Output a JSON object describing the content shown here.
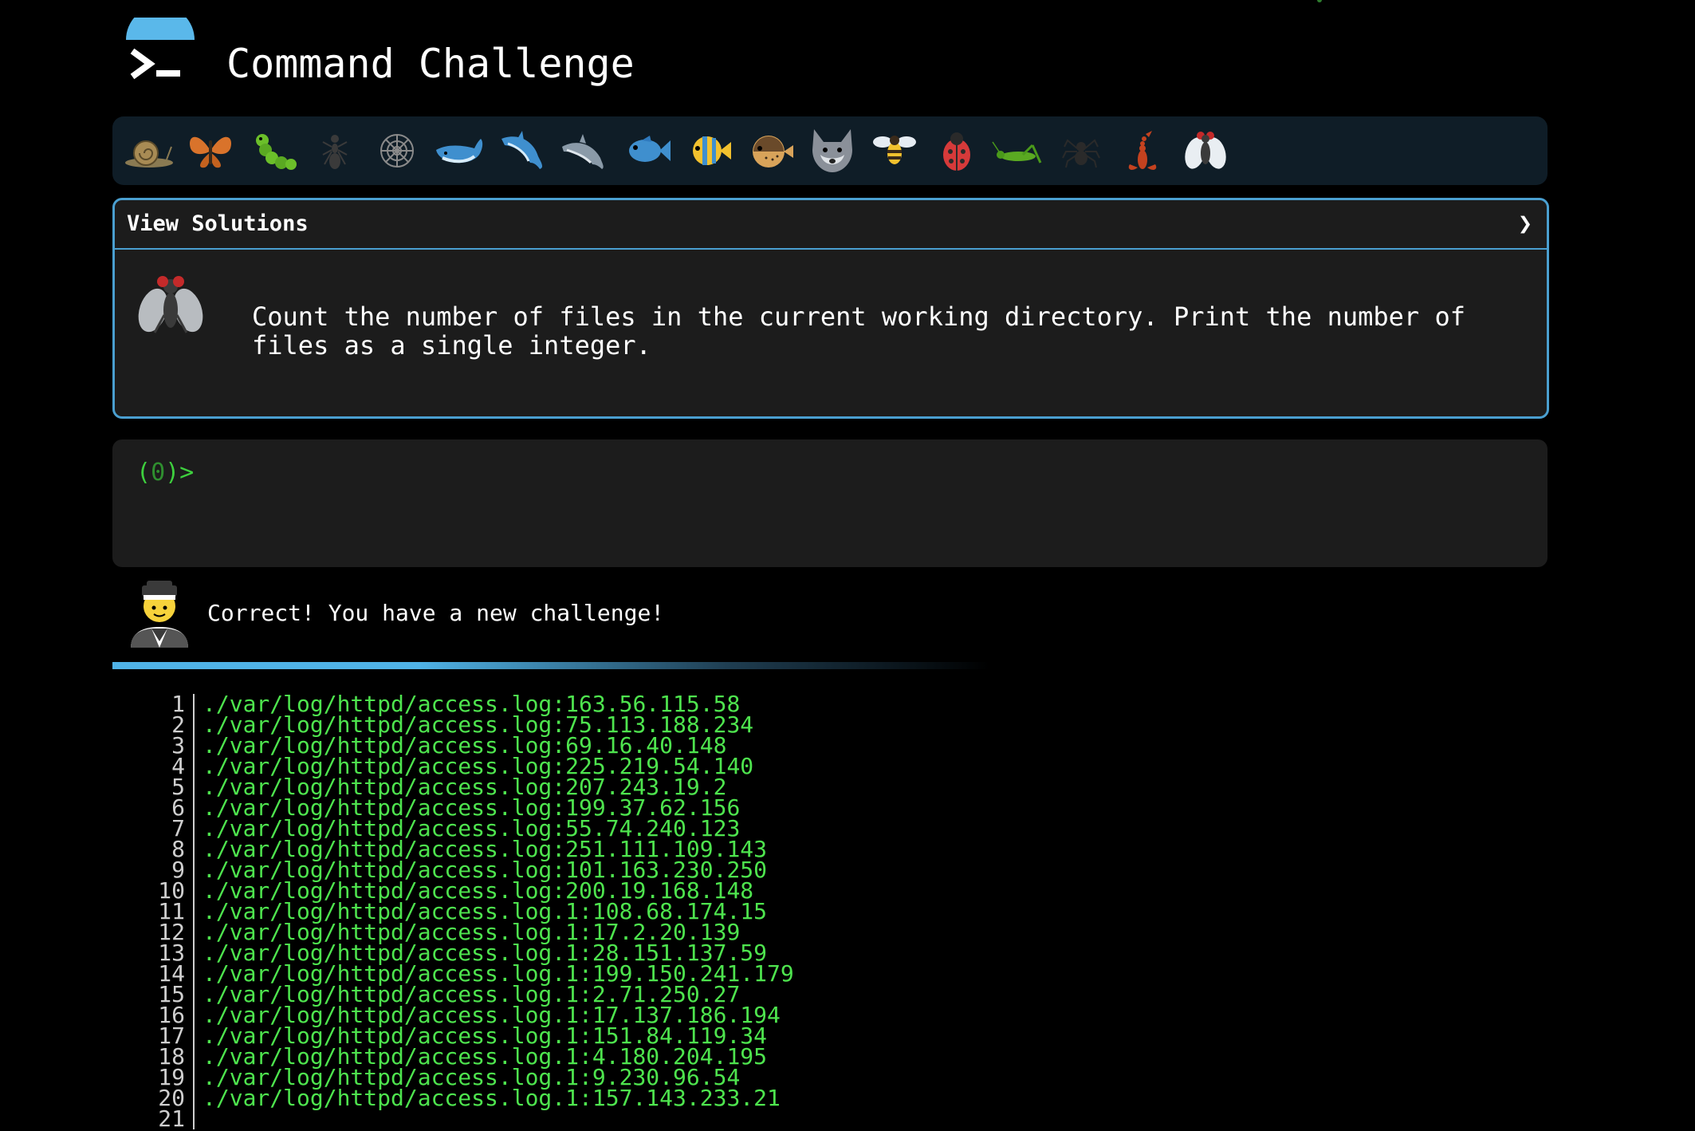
{
  "header": {
    "title": "Command Challenge",
    "logo_icon": "terminal-prompt-icon"
  },
  "challenge_icons": [
    "snail-icon",
    "butterfly-icon",
    "caterpillar-icon",
    "ant-icon",
    "spider-web-icon",
    "whale-icon",
    "dolphin-icon",
    "dolphin-icon",
    "fish-icon",
    "tropical-fish-icon",
    "blowfish-icon",
    "wolf-icon",
    "bee-icon",
    "ladybug-icon",
    "cricket-icon",
    "spider-icon",
    "scorpion-icon",
    "fly-icon"
  ],
  "solutions": {
    "label": "View Solutions",
    "chevron": "❯"
  },
  "challenge": {
    "icon": "fly-icon",
    "text": "Count the number of files in the current working directory. Print the number of files as a single integer."
  },
  "terminal": {
    "prompt_open": "(",
    "prompt_count": "0",
    "prompt_close": ")>",
    "input": ""
  },
  "status": {
    "avatar_icon": "student-avatar-icon",
    "message": "Correct! You have a new challenge!"
  },
  "output_lines": [
    {
      "num": "1",
      "text": "./var/log/httpd/access.log:163.56.115.58"
    },
    {
      "num": "2",
      "text": "./var/log/httpd/access.log:75.113.188.234"
    },
    {
      "num": "3",
      "text": "./var/log/httpd/access.log:69.16.40.148"
    },
    {
      "num": "4",
      "text": "./var/log/httpd/access.log:225.219.54.140"
    },
    {
      "num": "5",
      "text": "./var/log/httpd/access.log:207.243.19.2"
    },
    {
      "num": "6",
      "text": "./var/log/httpd/access.log:199.37.62.156"
    },
    {
      "num": "7",
      "text": "./var/log/httpd/access.log:55.74.240.123"
    },
    {
      "num": "8",
      "text": "./var/log/httpd/access.log:251.111.109.143"
    },
    {
      "num": "9",
      "text": "./var/log/httpd/access.log:101.163.230.250"
    },
    {
      "num": "10",
      "text": "./var/log/httpd/access.log:200.19.168.148"
    },
    {
      "num": "11",
      "text": "./var/log/httpd/access.log.1:108.68.174.15"
    },
    {
      "num": "12",
      "text": "./var/log/httpd/access.log.1:17.2.20.139"
    },
    {
      "num": "13",
      "text": "./var/log/httpd/access.log.1:28.151.137.59"
    },
    {
      "num": "14",
      "text": "./var/log/httpd/access.log.1:199.150.241.179"
    },
    {
      "num": "15",
      "text": "./var/log/httpd/access.log.1:2.71.250.27"
    },
    {
      "num": "16",
      "text": "./var/log/httpd/access.log.1:17.137.186.194"
    },
    {
      "num": "17",
      "text": "./var/log/httpd/access.log.1:151.84.119.34"
    },
    {
      "num": "18",
      "text": "./var/log/httpd/access.log.1:4.180.204.195"
    },
    {
      "num": "19",
      "text": "./var/log/httpd/access.log.1:9.230.96.54"
    },
    {
      "num": "20",
      "text": "./var/log/httpd/access.log.1:157.143.233.21"
    },
    {
      "num": "21",
      "text": ""
    }
  ],
  "colors": {
    "background": "#000000",
    "accent": "#4a9fd0",
    "terminal_green": "#4ee44e",
    "panel": "#1c1c1c",
    "strip": "#0f1d27"
  }
}
